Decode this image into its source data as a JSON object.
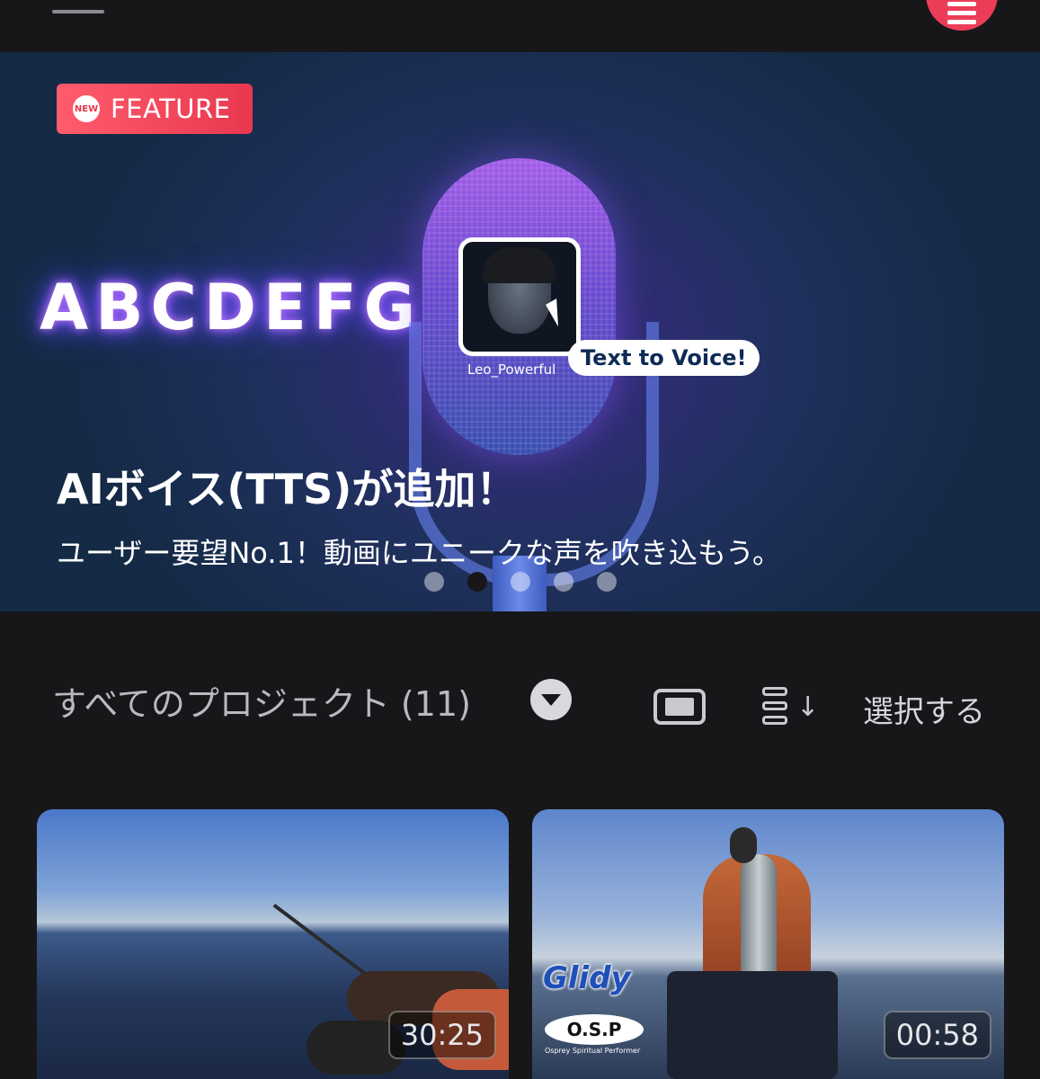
{
  "banner": {
    "badge_new": "NEW",
    "badge_label": "FEATURE",
    "glow_text": "ABCDEFG",
    "avatar_name": "Leo_Powerful",
    "tts_bubble": "Text to Voice!",
    "title": "AIボイス(TTS)が追加！",
    "subtitle": "ユーザー要望No.1！動画にユニークな声を吹き込もう。",
    "pager": {
      "count": 5,
      "active_index": 1
    }
  },
  "projects": {
    "title": "すべてのプロジェクト (11)",
    "select_label": "選択する",
    "icons": [
      "filter-dropdown-icon",
      "view-mode-icon",
      "sort-icon"
    ]
  },
  "cards": [
    {
      "duration": "30:25"
    },
    {
      "duration": "00:58",
      "watermark_1": "Glidy",
      "watermark_2": "O.S.P",
      "watermark_3": "Osprey Spiritual Performer"
    }
  ],
  "colors": {
    "accent": "#ec3d58",
    "background": "#17171a"
  }
}
